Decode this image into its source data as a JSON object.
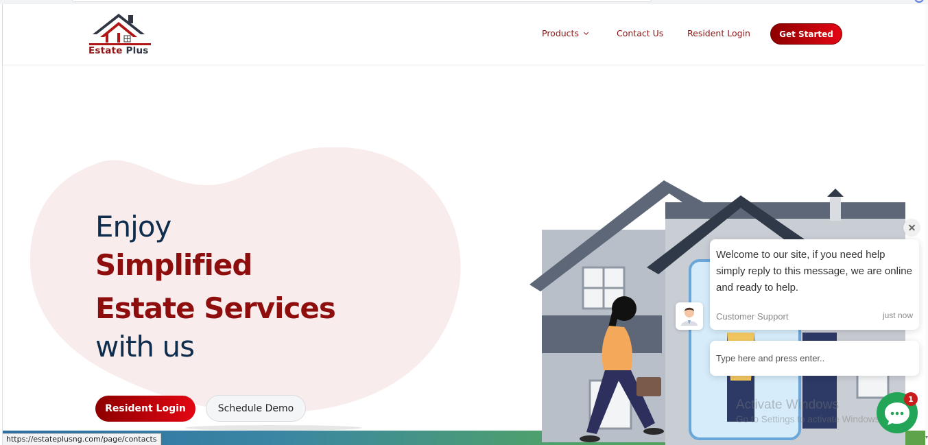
{
  "brand": {
    "name_main": "Estate",
    "name_accent": "Plus",
    "colors": {
      "primary": "#8e0e0e",
      "accent": "#e30613",
      "navy": "#0f2d4d"
    }
  },
  "nav": {
    "products": "Products",
    "contact": "Contact Us",
    "resident_login": "Resident Login",
    "get_started": "Get Started"
  },
  "hero": {
    "line1": "Enjoy",
    "line2": "Simplified",
    "line3": "Estate Services",
    "line4": "with us",
    "primary_button": "Resident Login",
    "secondary_button": "Schedule Demo"
  },
  "chat": {
    "message": "Welcome to our site, if you need help simply reply to this message, we are online and ready to help.",
    "agent": "Customer Support",
    "time": "just now",
    "input_placeholder": "Type here and press enter..",
    "badge_count": "1"
  },
  "status_bar": {
    "url": "https://estateplusng.com/page/contacts"
  },
  "watermark": {
    "title": "Activate Windows",
    "subtitle": "Go to Settings to activate Windows."
  },
  "icons": {
    "logo": "house-roof-logo",
    "close": "close-icon",
    "launcher": "chat-bubble-icon",
    "avatar": "support-agent-icon",
    "products_caret": "chevron-down-icon"
  }
}
